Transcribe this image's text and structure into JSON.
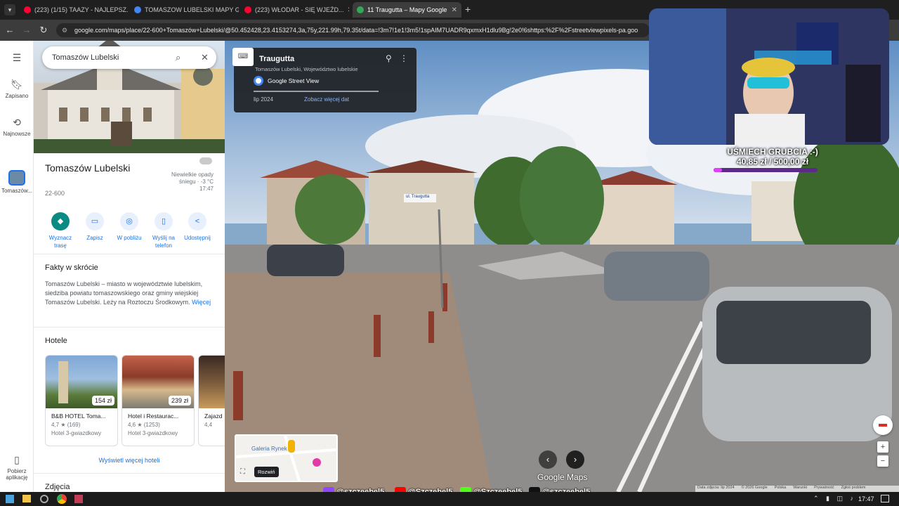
{
  "browser": {
    "tabs": [
      {
        "title": "(223) (1/15) TAAZY - NAJLEPSZ...",
        "color": "#ff0033",
        "active": false
      },
      {
        "title": "TOMASZOW LUBELSKI MAPY G...",
        "color": "#4285f4",
        "active": false
      },
      {
        "title": "(223) WŁODAR - SIĘ WJEŹD...",
        "color": "#ff0033",
        "active": false
      },
      {
        "title": "11 Traugutta – Mapy Google",
        "color": "#34a853",
        "active": true
      }
    ],
    "new_tab": "+",
    "url": "google.com/maps/place/22-600+Tomaszów+Lubelski/@50.452428,23.4153274,3a,75y,221.99h,79.35t/data=!3m7!1e1!3m5!1spAIM7UADR9qxmxH1dlu9Bg!2e0!6shttps:%2F%2Fstreetviewpixels-pa.goo"
  },
  "rail": {
    "items": [
      {
        "label": "Zapisano",
        "icon": "bookmark-icon"
      },
      {
        "label": "Najnowsze",
        "icon": "history-icon"
      },
      {
        "label": "Tomaszów...",
        "icon": "place-thumb"
      },
      {
        "label": "Pobierz aplikację",
        "icon": "phone-icon"
      }
    ]
  },
  "panel": {
    "search_value": "Tomaszów Lubelski",
    "place_title": "Tomaszów Lubelski",
    "place_sub": "22-600",
    "weather": [
      "Niewielkie opady",
      "śniegu · -3 °C",
      "17:47"
    ],
    "actions": [
      {
        "label": "Wyznacz trasę",
        "icon": "directions-icon"
      },
      {
        "label": "Zapisz",
        "icon": "bookmark-icon"
      },
      {
        "label": "W pobliżu",
        "icon": "nearby-icon"
      },
      {
        "label": "Wyślij na telefon",
        "icon": "send-to-phone-icon"
      },
      {
        "label": "Udostępnij",
        "icon": "share-icon"
      }
    ],
    "facts_title": "Fakty w skrócie",
    "facts_text": "Tomaszów Lubelski – miasto w województwie lubelskim, siedziba powiatu tomaszowskiego oraz gminy wiejskiej Tomaszów Lubelski. Leży na Roztoczu Środkowym.",
    "facts_more": "Więcej",
    "hotels_title": "Hotele",
    "hotels": [
      {
        "name": "B&B HOTEL Toma...",
        "rating": "4,7 ★ (169)",
        "class": "Hotel 3-gwiazdkowy",
        "price": "154 zł"
      },
      {
        "name": "Hotel i Restaurac...",
        "rating": "4,6 ★ (1253)",
        "class": "Hotel 3-gwiazdkowy",
        "price": "239 zł"
      },
      {
        "name": "Zajazd",
        "rating": "4,4",
        "class": "",
        "price": ""
      }
    ],
    "more_hotels": "Wyświetl więcej hoteli",
    "photos_title": "Zdjęcia"
  },
  "streetview": {
    "street": "Traugutta",
    "locality": "Tomaszów Lubelski, Województwo lubelskie",
    "provider": "Google Street View",
    "date": "lip 2024",
    "more_dates": "Zobacz więcej dat",
    "sign_text": "ul. Traugutta",
    "minimap_label": "Galeria Rynek",
    "expand_label": "Rozwiń",
    "watermark": "Google Maps",
    "footer": [
      "Data zdjęcia: lip 2024",
      "© 2026 Google",
      "Polska",
      "Warunki",
      "Prywatność",
      "Zgłoś problem"
    ]
  },
  "overlay": {
    "donate_title": "UŚMIECH GRUBCIA :-)",
    "donate_amount": "40,85 zł",
    "donate_sep": "/",
    "donate_goal": "500,00 zł",
    "donate_progress": 0.08,
    "socials": [
      {
        "handle": "@szczeebel5",
        "color": "#9146ff"
      },
      {
        "handle": "@Szczebel5",
        "color": "#ff0000"
      },
      {
        "handle": "@Szczeebel5",
        "color": "#53fc18"
      },
      {
        "handle": "@szczeebel5",
        "color": "#111111"
      }
    ]
  },
  "taskbar": {
    "clock": "17:47"
  }
}
